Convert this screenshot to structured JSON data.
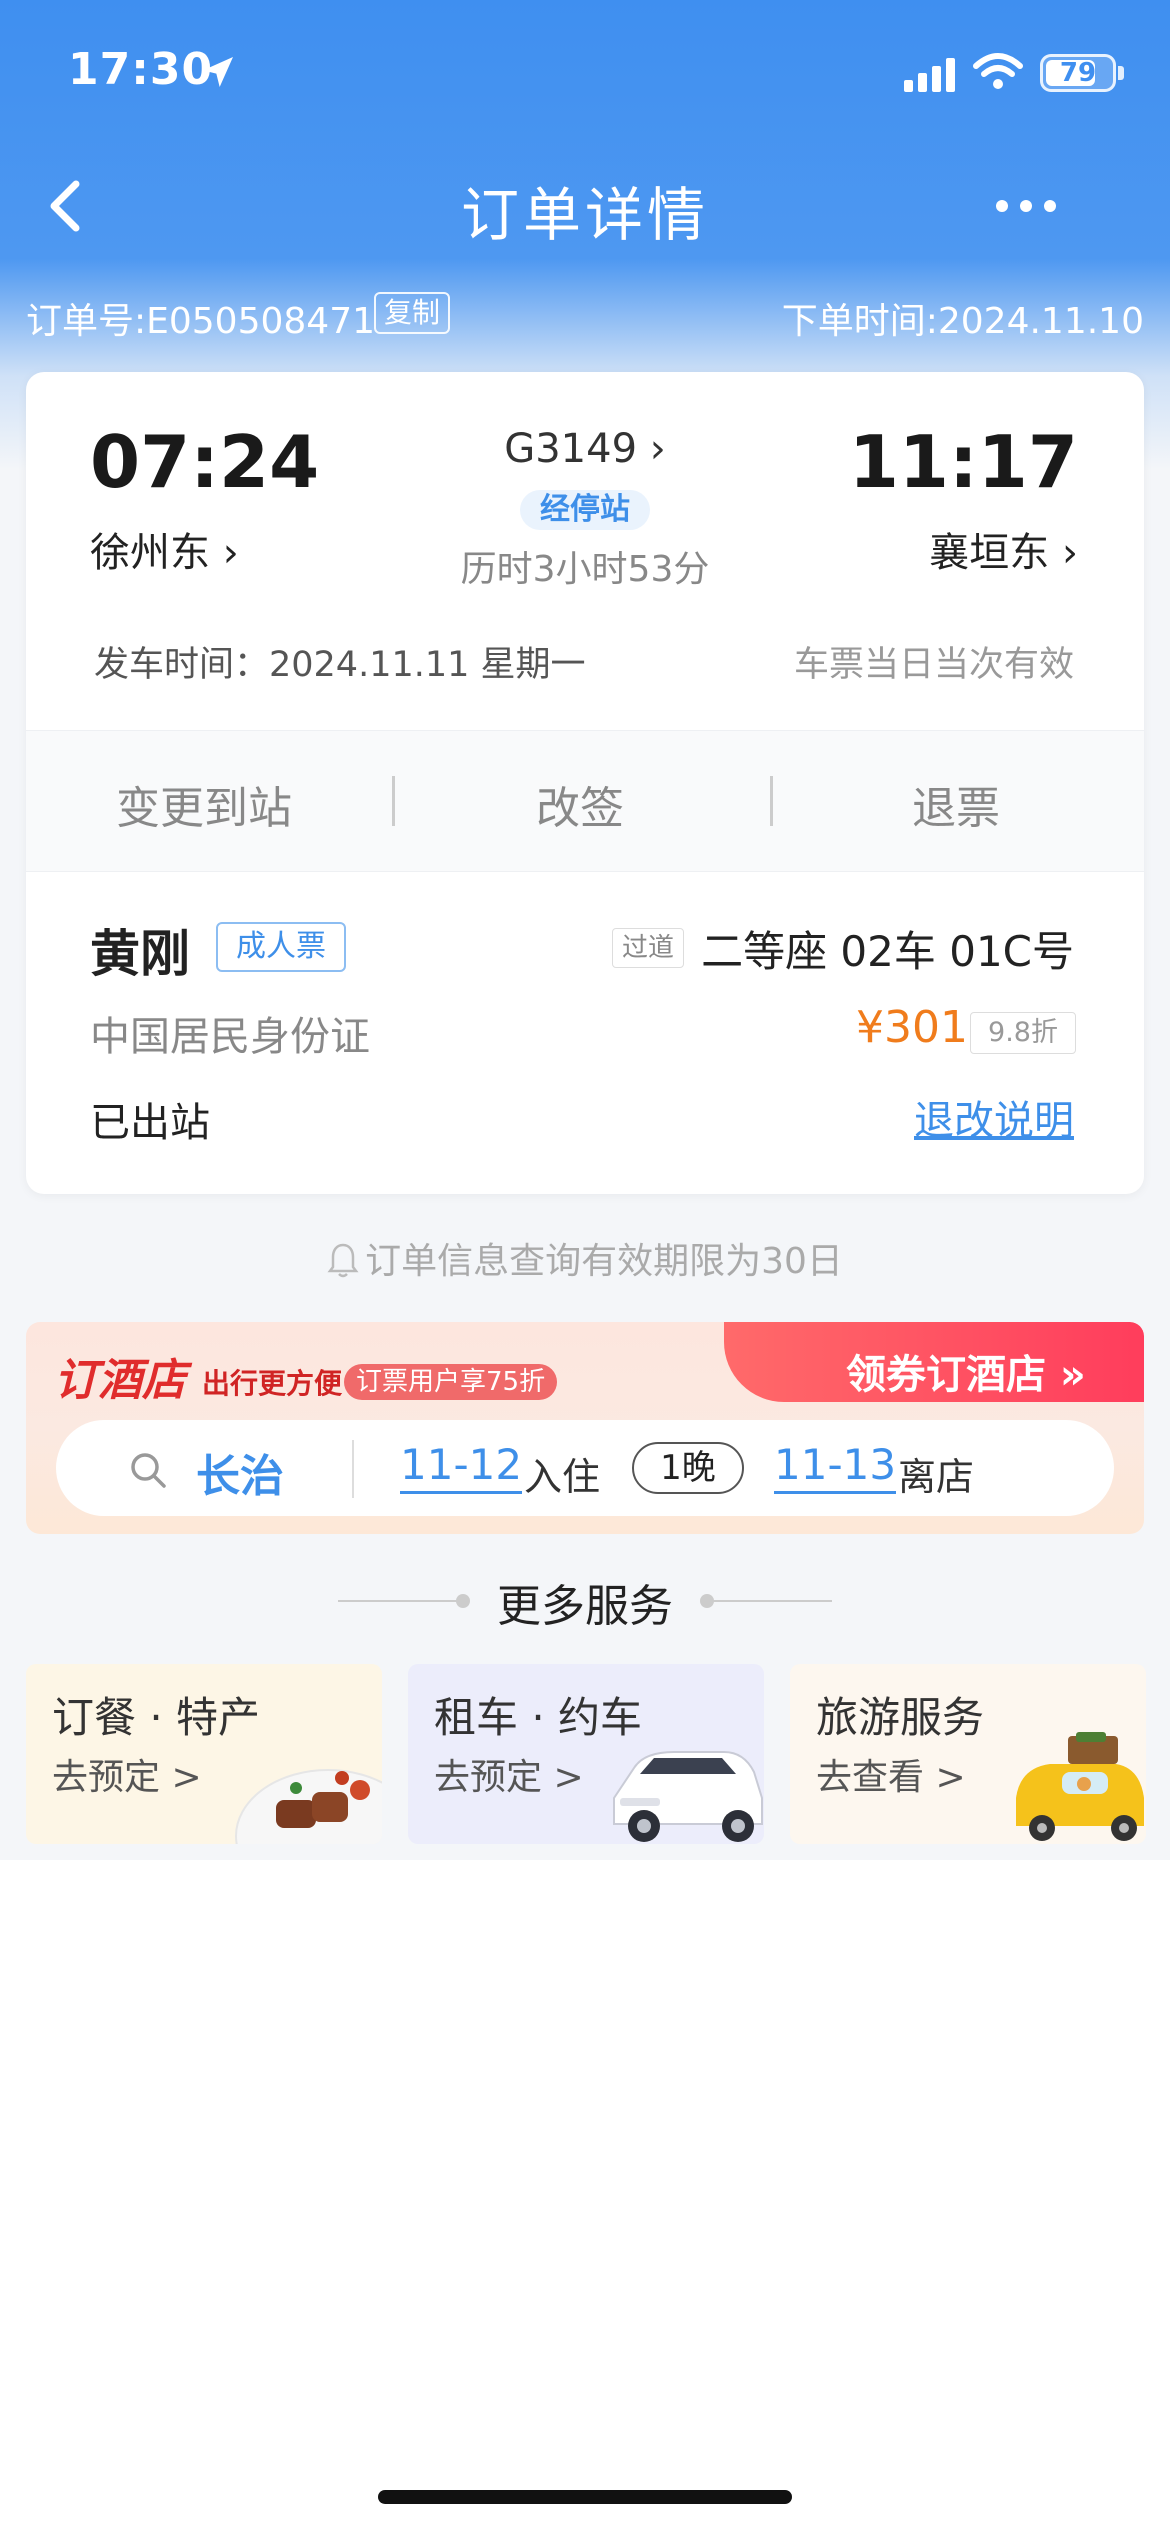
{
  "status_bar": {
    "time": "17:30",
    "battery": "79",
    "battery_level": 0.79
  },
  "nav": {
    "title": "订单详情"
  },
  "order": {
    "number_label": "订单号:E050508471",
    "copy_label": "复制",
    "order_time": "下单时间:2024.11.10"
  },
  "trip": {
    "depart_time": "07:24",
    "depart_station": "徐州东 ›",
    "arrive_time": "11:17",
    "arrive_station": "襄垣东 ›",
    "train_no": "G3149 ›",
    "stops_tag": "经停站",
    "duration": "历时3小时53分",
    "depart_date": "发车时间：2024.11.11 星期一",
    "validity": "车票当日当次有效"
  },
  "actions": {
    "change_station": "变更到站",
    "rebook": "改签",
    "refund": "退票"
  },
  "passenger": {
    "name": "黄刚",
    "ticket_type": "成人票",
    "seat_position": "过道",
    "seat": "二等座 02车 01C号",
    "id_type": "中国居民身份证",
    "price": "¥301",
    "discount": "9.8折",
    "status": "已出站",
    "refund_rules": "退改说明"
  },
  "notice": "订单信息查询有效期限为30日",
  "hotel": {
    "logo": "订酒店",
    "subtitle": "出行更方便",
    "promo": "订票用户享75折",
    "cta": "领券订酒店 »",
    "city": "长治",
    "checkin_date": "11-12",
    "checkin_label": "入住",
    "nights": "1晚",
    "checkout_date": "11-13",
    "checkout_label": "离店"
  },
  "services": {
    "title": "更多服务",
    "items": [
      {
        "title": "订餐 · 特产",
        "sub": "去预定 >"
      },
      {
        "title": "租车 · 约车",
        "sub": "去预定 >"
      },
      {
        "title": "旅游服务",
        "sub": "去查看 >"
      }
    ]
  },
  "colors": {
    "brand_blue": "#3f8ff0",
    "link_blue": "#3e8fe9",
    "price_orange": "#f07c1c",
    "hotel_red": "#e02c2c"
  }
}
